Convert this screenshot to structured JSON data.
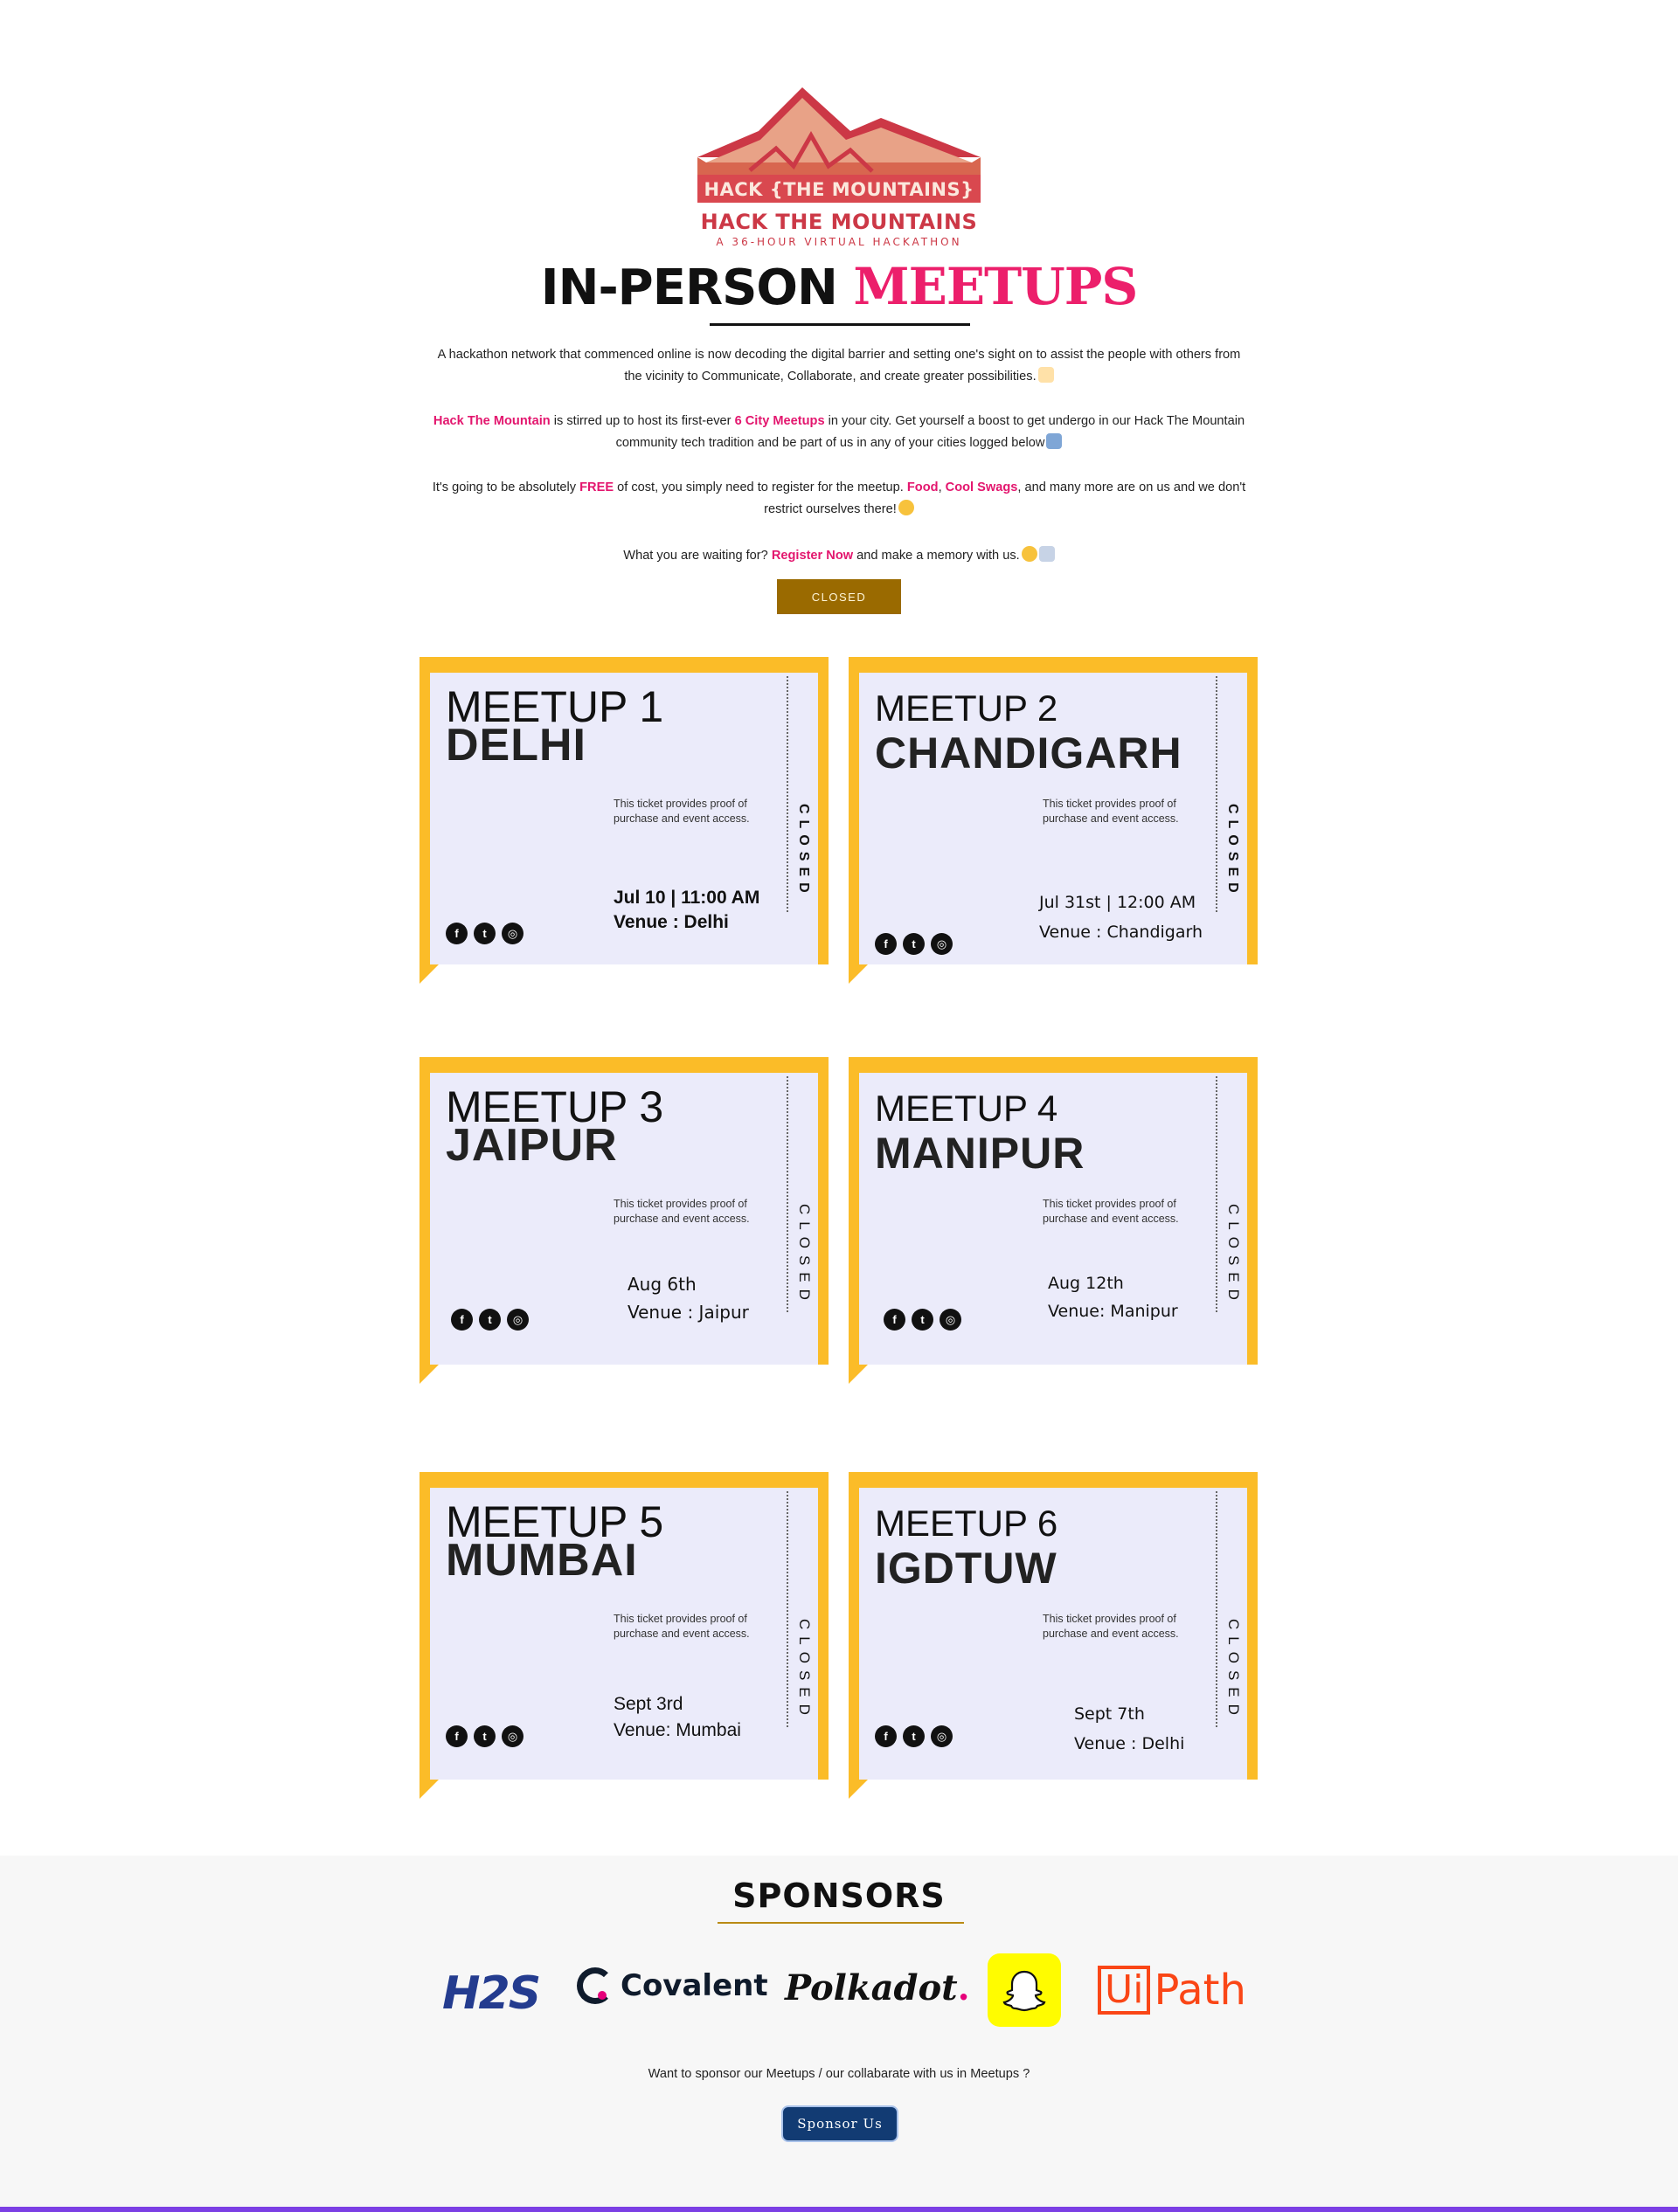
{
  "logo": {
    "badge": "HACK {THE MOUNTAINS}",
    "name": "HACK THE MOUNTAINS",
    "tagline": "A 36-HOUR VIRTUAL HACKATHON",
    "colors": {
      "primary": "#cc3846",
      "peach": "#e8a287"
    }
  },
  "headline": {
    "part1": "IN-PERSON",
    "part2": "MEETUPS"
  },
  "intro": {
    "p1": "A hackathon network that commenced online is now decoding the digital barrier and setting one's sight on to assist the people with others from the vicinity to Communicate, Collaborate, and create greater possibilities.",
    "p2": {
      "hl1": "Hack The Mountain",
      "t1": " is stirred up to host its first-ever ",
      "hl2": "6 City Meetups",
      "t2": " in your city. Get yourself a boost to get undergo in our Hack The Mountain community tech tradition and be part of us in any of your cities logged below"
    },
    "p3": {
      "t1": "It's going to be absolutely ",
      "hl1": "FREE",
      "t2": " of cost, you simply need to register for the meetup. ",
      "hl2": "Food",
      "t3": ", ",
      "hl3": "Cool Swags",
      "t4": ", and many more are on us and we don't restrict ourselves there!"
    },
    "p4": {
      "t1": "What you are waiting for? ",
      "hl1": "Register Now",
      "t2": " and make a memory with us."
    }
  },
  "closed_button": "CLOSED",
  "tickets": [
    {
      "title": "MEETUP 1",
      "city": "DELHI",
      "note": "This ticket provides proof of purchase and event access.",
      "date": "Jul 10 | 11:00 AM",
      "venue": "Venue : Delhi",
      "status": "CLOSED"
    },
    {
      "title": "MEETUP 2",
      "city": "CHANDIGARH",
      "note": "This ticket provides proof of purchase and event access.",
      "date": "Jul 31st | 12:00 AM",
      "venue": "Venue : Chandigarh",
      "status": "CLOSED"
    },
    {
      "title": "MEETUP 3",
      "city": "JAIPUR",
      "note": "This ticket provides proof of purchase and event access.",
      "date": "Aug 6th",
      "venue": "Venue : Jaipur",
      "status": "CLOSED"
    },
    {
      "title": "MEETUP 4",
      "city": "MANIPUR",
      "note": "This ticket provides proof of purchase and event access.",
      "date": "Aug 12th",
      "venue": "Venue: Manipur",
      "status": "CLOSED"
    },
    {
      "title": "MEETUP 5",
      "city": "MUMBAI",
      "note": "This ticket provides proof of purchase and event access.",
      "date": "Sept 3rd",
      "venue": "Venue: Mumbai",
      "status": "CLOSED"
    },
    {
      "title": "MEETUP 6",
      "city": "IGDTUW",
      "note": "This ticket provides proof of purchase and event access.",
      "date": "Sept 7th",
      "venue": "Venue : Delhi",
      "status": "CLOSED"
    }
  ],
  "social_icons": [
    "facebook-icon",
    "twitter-icon",
    "instagram-icon"
  ],
  "sponsors": {
    "title": "SPONSORS",
    "logos": {
      "h2s": "H2S",
      "covalent": "Covalent",
      "polkadot": "Polkadot",
      "snapchat": "snapchat-ghost",
      "uipath_box": "Ui",
      "uipath_text": "Path"
    },
    "question": "Want to sponsor our Meetups / our collabarate with us in Meetups ?",
    "button": "Sponsor Us"
  },
  "colors": {
    "accent_pink": "#e3166e",
    "ticket_yellow": "#fbbc28",
    "ticket_body": "#ebebfa",
    "closed_btn": "#9a6a00",
    "sponsor_btn": "#123b73",
    "footer_bar": "#7b3fe4"
  }
}
